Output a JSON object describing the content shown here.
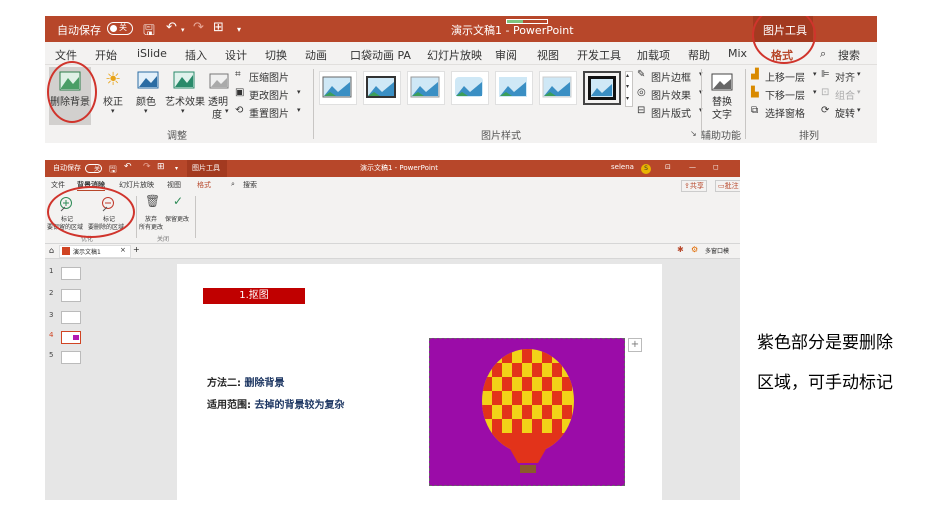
{
  "top": {
    "titlebar": {
      "autosave_label": "自动保存",
      "autosave_state": "关",
      "doc_title": "演示文稿1 - PowerPoint",
      "picture_tools_label": "图片工具",
      "bg_color": "#b7472a"
    },
    "tabs": [
      "文件",
      "开始",
      "iSlide",
      "插入",
      "设计",
      "切换",
      "动画",
      "口袋动画 PA",
      "幻灯片放映",
      "审阅",
      "视图",
      "开发工具",
      "加载项",
      "帮助",
      "Mix",
      "格式"
    ],
    "selected_tab": "格式",
    "search_label": "搜索",
    "ribbon": {
      "adjust": {
        "remove_bg": "删除背景",
        "correct": "校正",
        "color": "颜色",
        "artistic": "艺术效果",
        "transparency_1": "透明",
        "transparency_2": "度",
        "compress": "压缩图片",
        "change": "更改图片",
        "reset": "重置图片",
        "group_label": "调整"
      },
      "styles": {
        "border": "图片边框",
        "effects": "图片效果",
        "layout": "图片版式",
        "group_label": "图片样式"
      },
      "accessibility": {
        "alt_text_1": "替换",
        "alt_text_2": "文字",
        "group_label": "辅助功能"
      },
      "arrange": {
        "bring_forward": "上移一层",
        "send_backward": "下移一层",
        "selection_pane": "选择窗格",
        "align": "对齐",
        "group": "组合",
        "rotate": "旋转",
        "group_label": "排列"
      }
    },
    "annotation_color": "#d0342c"
  },
  "bottom": {
    "titlebar": {
      "autosave_label": "自动保存",
      "autosave_state": "关",
      "picture_tools_label": "图片工具",
      "doc_title": "演示文稿1 - PowerPoint",
      "user": "selena",
      "user_initial": "S"
    },
    "tabs": [
      "文件",
      "背景消除",
      "幻灯片放映",
      "视图",
      "格式"
    ],
    "search_label": "搜索",
    "share_label": "共享",
    "comment_label": "批注",
    "ribbon": {
      "mark_keep_1": "标记",
      "mark_keep_2": "要保留的区域",
      "mark_remove_1": "标记",
      "mark_remove_2": "要删除的区域",
      "discard_1": "放弃",
      "discard_2": "所有更改",
      "keep_changes": "保留更改",
      "group_optimize": "优化",
      "group_close": "关闭"
    },
    "doc_tab": "演示文稿1",
    "right_pane_label": "多窗口模",
    "slide_numbers": [
      "1",
      "2",
      "3",
      "4",
      "5"
    ],
    "slide": {
      "title_box": "1.抠图",
      "method_label": "方法二:",
      "method_value": "删除背景",
      "scope_label": "适用范围:",
      "scope_value": "去掉的背景较为复杂",
      "purple_color": "#9b0ca8",
      "title_red": "#c00000",
      "blue_text": "#1f3864"
    }
  },
  "note": {
    "line1": "紫色部分是要删除",
    "line2": "区域，可手动标记"
  }
}
